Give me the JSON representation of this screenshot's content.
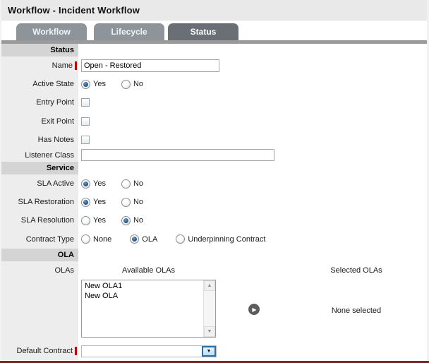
{
  "title": "Workflow - Incident Workflow",
  "tabs": {
    "workflow": "Workflow",
    "lifecycle": "Lifecycle",
    "status": "Status",
    "active_tab": "Status"
  },
  "sections": {
    "status": "Status",
    "service": "Service",
    "ola": "OLA"
  },
  "radio": {
    "yes": "Yes",
    "no": "No"
  },
  "fields": {
    "name": {
      "label": "Name",
      "value": "Open - Restored",
      "required": true
    },
    "active_state": {
      "label": "Active State",
      "selected": "Yes"
    },
    "entry_point": {
      "label": "Entry Point",
      "checked": false
    },
    "exit_point": {
      "label": "Exit Point",
      "checked": false
    },
    "has_notes": {
      "label": "Has Notes",
      "checked": false
    },
    "listener_class": {
      "label": "Listener Class",
      "value": ""
    },
    "sla_active": {
      "label": "SLA Active",
      "selected": "Yes"
    },
    "sla_restoration": {
      "label": "SLA Restoration",
      "selected": "Yes"
    },
    "sla_resolution": {
      "label": "SLA Resolution",
      "selected": "No"
    },
    "contract_type": {
      "label": "Contract Type",
      "options": [
        "None",
        "OLA",
        "Underpinning Contract"
      ],
      "selected": "OLA"
    },
    "olas": {
      "label": "OLAs",
      "available_heading": "Available OLAs",
      "selected_heading": "Selected OLAs",
      "available": [
        "New OLA1",
        "New OLA"
      ],
      "none_selected": "None selected"
    },
    "default_contract": {
      "label": "Default Contract",
      "value": "",
      "required": true
    }
  },
  "icons": {
    "move_right": "▶",
    "scroll_up": "▲",
    "scroll_down": "▼",
    "dropdown": "▼"
  },
  "colors": {
    "tab_active": "#696f75",
    "tab_inactive": "#8d959b",
    "panel_bar": "#9a9a9a",
    "section_bg": "#d4d4d4",
    "label_bg": "#ededed",
    "required_marker": "#c00000",
    "radio_dot": "#1e4e79",
    "combo_button_border": "#2f6e9e",
    "bottom_accent": "#7d2626"
  }
}
